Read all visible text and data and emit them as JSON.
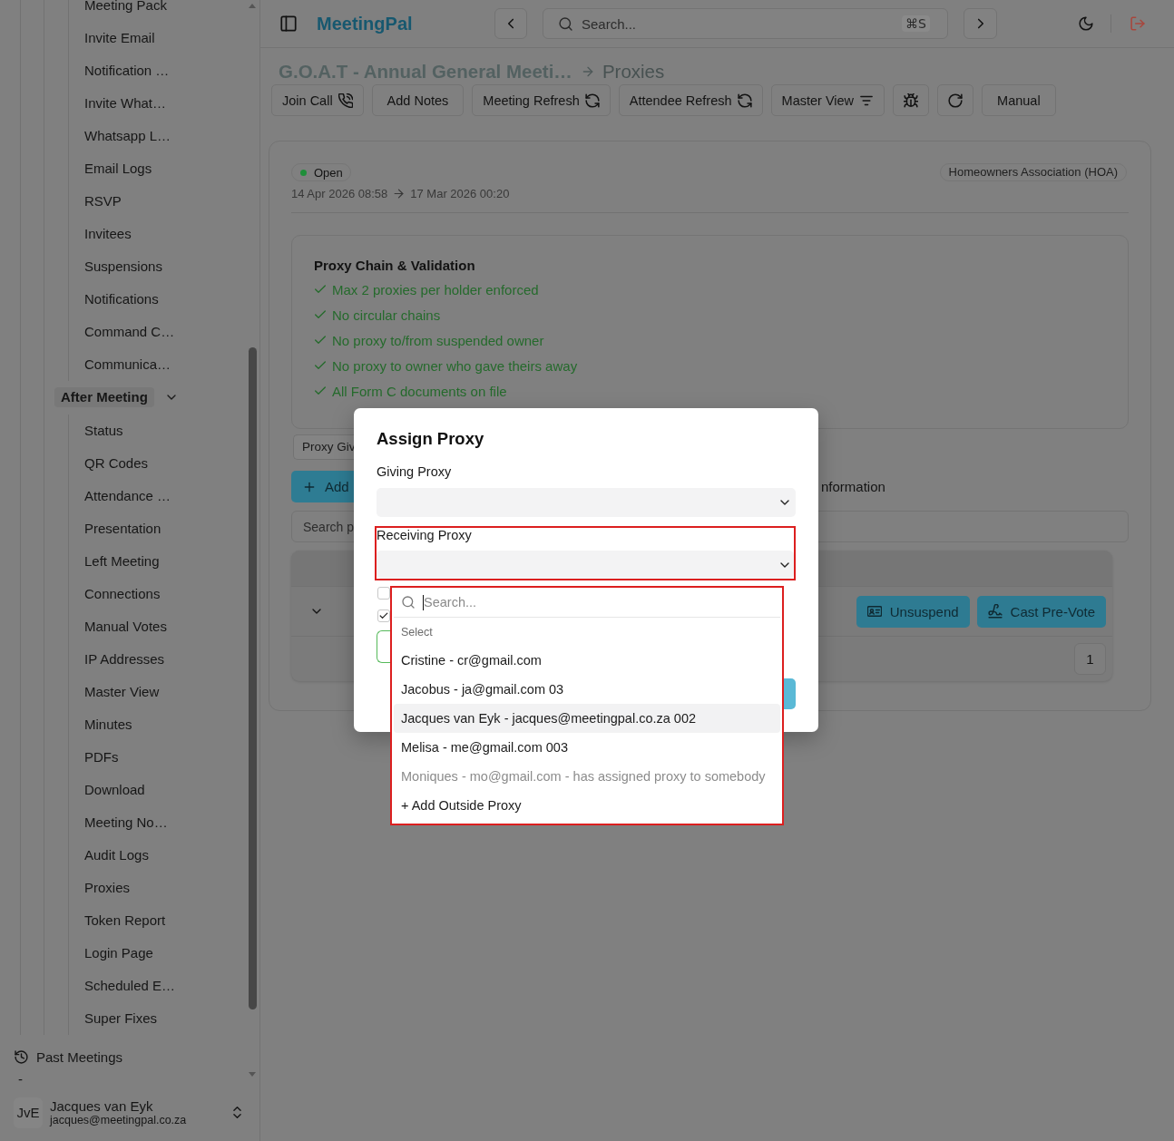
{
  "sidebar": {
    "tree": [
      {
        "children": [
          {
            "label": "Meeting Pack"
          },
          {
            "label": "Invite Email"
          },
          {
            "label": "Notification …"
          },
          {
            "label": "Invite What…"
          },
          {
            "label": "Whatsapp L…"
          },
          {
            "label": "Email Logs"
          },
          {
            "label": "RSVP"
          },
          {
            "label": "Invitees"
          },
          {
            "label": "Suspensions"
          },
          {
            "label": "Notifications"
          },
          {
            "label": "Command C…"
          },
          {
            "label": "Communica…"
          }
        ]
      },
      {
        "label": "After Meeting",
        "expanded": true,
        "children": [
          {
            "label": "Status"
          },
          {
            "label": "QR Codes"
          },
          {
            "label": "Attendance …"
          },
          {
            "label": "Presentation"
          },
          {
            "label": "Left Meeting"
          },
          {
            "label": "Connections"
          },
          {
            "label": "Manual Votes"
          },
          {
            "label": "IP Addresses"
          },
          {
            "label": "Master View"
          },
          {
            "label": "Minutes"
          },
          {
            "label": "PDFs"
          },
          {
            "label": "Download"
          },
          {
            "label": "Meeting No…"
          },
          {
            "label": "Audit Logs"
          },
          {
            "label": "Proxies"
          },
          {
            "label": "Token Report"
          },
          {
            "label": "Login Page"
          },
          {
            "label": "Scheduled E…"
          },
          {
            "label": "Super Fixes"
          }
        ]
      }
    ],
    "past_meetings": "Past Meetings",
    "note": "-",
    "user": {
      "initials": "JvE",
      "name": "Jacques van Eyk",
      "email": "jacques@meetingpal.co.za"
    }
  },
  "topbar": {
    "app_name": "MeetingPal",
    "search": {
      "placeholder": "Search...",
      "shortcut": "⌘S"
    }
  },
  "header": {
    "meeting": "G.O.A.T - Annual General Meeti…",
    "current": "Proxies"
  },
  "toolbar": [
    {
      "kind": "call",
      "label": "Join Call"
    },
    {
      "kind": "text",
      "label": "Add Notes"
    },
    {
      "kind": "refresh",
      "label": "Meeting Refresh"
    },
    {
      "kind": "refresh",
      "label": "Attendee Refresh"
    },
    {
      "kind": "view",
      "label": "Master View"
    },
    {
      "kind": "debug"
    },
    {
      "kind": "reload"
    },
    {
      "kind": "text",
      "label": "Manual"
    }
  ],
  "meeting": {
    "status": {
      "label": "Open",
      "kind": "open"
    },
    "start": "14 Apr 2026 08:58",
    "end": "17 Mar 2026 00:20",
    "category": "Homeowners Association (HOA)",
    "validation": {
      "title": "Proxy Chain & Validation",
      "checks": [
        {
          "label": "Max 2 proxies per holder enforced",
          "passed": true
        },
        {
          "label": "No circular chains",
          "passed": true
        },
        {
          "label": "No proxy to/from suspended owner",
          "passed": true
        },
        {
          "label": "No proxy to owner who gave theirs away",
          "passed": true
        },
        {
          "label": "All Form C documents on file",
          "passed": true
        }
      ]
    },
    "tabs": [
      {
        "label": "Proxy Giv",
        "selected": true
      }
    ],
    "add_button": "Add",
    "side_text": "nformation",
    "search": {
      "placeholder": "Search p"
    },
    "table": {
      "rows": [
        {
          "expanded": false,
          "actions": [
            {
              "kind": "unsuspend",
              "label": "Unsuspend"
            },
            {
              "kind": "pre-vote",
              "label": "Cast Pre-Vote"
            }
          ]
        }
      ],
      "pages": [
        "1"
      ]
    }
  },
  "modal": {
    "title": "Assign Proxy",
    "giving_proxy": {
      "label": "Giving Proxy"
    },
    "receiving_proxy": {
      "label": "Receiving Proxy",
      "flagged": true
    },
    "options": [
      {
        "checked": false
      },
      {
        "checked": true
      }
    ],
    "dropdown": {
      "flagged": true,
      "search": {
        "placeholder": "Search...",
        "focused": true
      },
      "group": "Select",
      "items": [
        {
          "label": "Cristine - cr@gmail.com",
          "selected": false,
          "disabled": false
        },
        {
          "label": "Jacobus - ja@gmail.com 03",
          "selected": false,
          "disabled": false
        },
        {
          "label": "Jacques van Eyk - jacques@meetingpal.co.za 002",
          "selected": true,
          "disabled": false
        },
        {
          "label": "Melisa - me@gmail.com 003",
          "selected": false,
          "disabled": false
        },
        {
          "label": "Moniques - mo@gmail.com - has assigned proxy to somebody",
          "selected": false,
          "disabled": true
        },
        {
          "label": "+ Add Outside Proxy",
          "selected": false,
          "disabled": false
        }
      ]
    }
  }
}
